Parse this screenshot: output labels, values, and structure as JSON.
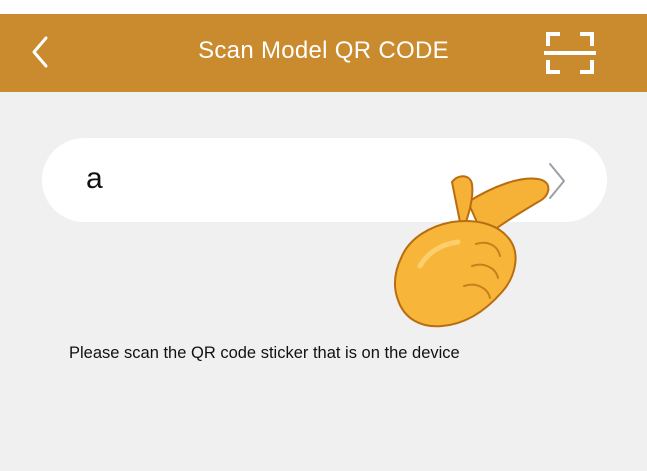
{
  "header": {
    "title": "Scan Model QR CODE",
    "background_color": "#c98b2d",
    "back_icon": "chevron-left-icon",
    "scan_icon": "scan-frame-icon"
  },
  "model_field": {
    "value": "a",
    "chevron_icon": "chevron-right-icon"
  },
  "overlay": {
    "icon": "pointing-hand-icon"
  },
  "hint": {
    "text": "Please scan the QR code sticker that is on the device"
  }
}
